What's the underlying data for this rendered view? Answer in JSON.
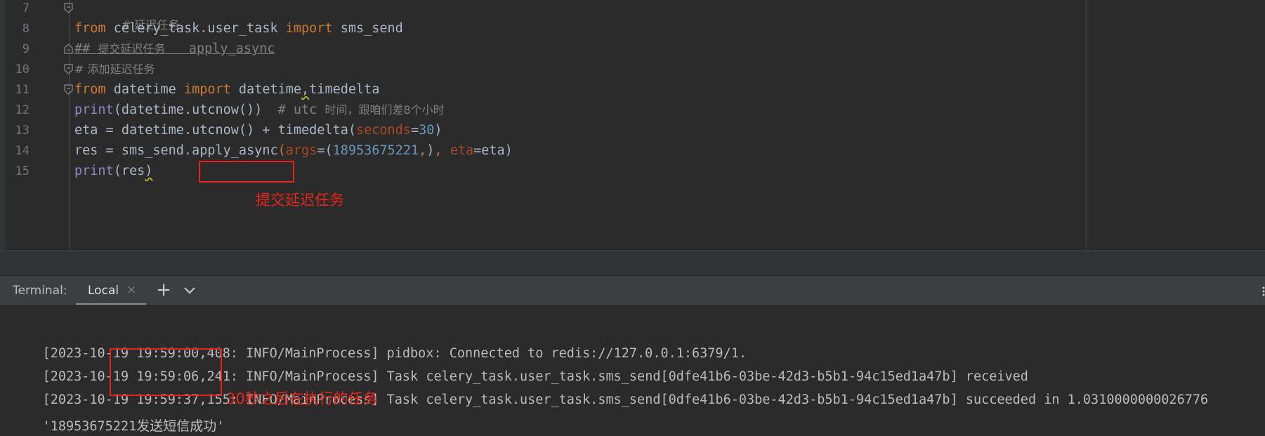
{
  "editor": {
    "lines": [
      {
        "num": "7"
      },
      {
        "num": "8"
      },
      {
        "num": "9"
      },
      {
        "num": "10"
      },
      {
        "num": "11"
      },
      {
        "num": "12"
      },
      {
        "num": "13"
      },
      {
        "num": "14"
      },
      {
        "num": "15"
      }
    ],
    "tokens": {
      "l7_comment": "# 延迟任务",
      "l8_from": "from",
      "l8_module": " celery_task.user_task ",
      "l8_import": "import",
      "l8_name": " sms_send",
      "l9_prefix": "## ",
      "l9_cn": "提交延迟任务",
      "l9_api": "   apply_async",
      "l10_comment": "# 添加延迟任务",
      "l11_from": "from",
      "l11_module": " datetime ",
      "l11_import": "import",
      "l11_name1": " datetime",
      "l11_comma": ",",
      "l11_name2": "timedelta",
      "l12_print": "print",
      "l12_args": "(datetime.utcnow())",
      "l12_comment_a": "  # utc ",
      "l12_comment_b": "时间，跟咱们差8个小时",
      "l13_a": "eta = datetime.utcnow() + timedelta(",
      "l13_kw": "seconds",
      "l13_eq": "=",
      "l13_num": "30",
      "l13_close": ")",
      "l14_a": "res = sms_send.",
      "l14_method": "apply_async",
      "l14_paren": "(",
      "l14_kw1": "args",
      "l14_eq1": "=(",
      "l14_num": "18953675221",
      "l14_comma": ",",
      "l14_close1": ")",
      "l14_sep": ", ",
      "l14_kw2": "eta",
      "l14_eq2": "=eta)",
      "l15_print": "print",
      "l15_paren": "(",
      "l15_res": "res",
      "l15_close": ")"
    },
    "annotation_submit": "提交延迟任务"
  },
  "terminal": {
    "title": "Terminal:",
    "tab_local": "Local",
    "tab_close": "×",
    "add": "+",
    "log": [
      {
        "prefix": "[2023-10-19 19:59:00,408: INFO/MainProcess] pidbox: Connected to redis://127.0.0.1:6379/1."
      },
      {
        "prefix": "[2023-10-19 ",
        "time": "19:59:06,241:",
        "rest": " INFO/MainProcess] Task celery_task.user_task.sms_send[0dfe41b6-03be-42d3-b5b1-94c15ed1a47b] received"
      },
      {
        "prefix": "[2023-10-19 ",
        "time": "19:59:37,155:",
        "rest": " INFO/MainProcess] Task celery_task.user_task.sms_send[0dfe41b6-03be-42d3-b5b1-94c15ed1a47b] succeeded in 1.0310000000026776"
      },
      {
        "q1": "'18953675221",
        "cn": "发送短信成功",
        "q2": "'"
      }
    ],
    "annotation_after": "30秒之后在执行的任务"
  },
  "colors": {
    "annotation_red": "#e8261a",
    "keyword": "#cc7832",
    "builtin": "#8888c6",
    "number": "#6897bb",
    "param": "#aa4926",
    "comment": "#808080"
  }
}
